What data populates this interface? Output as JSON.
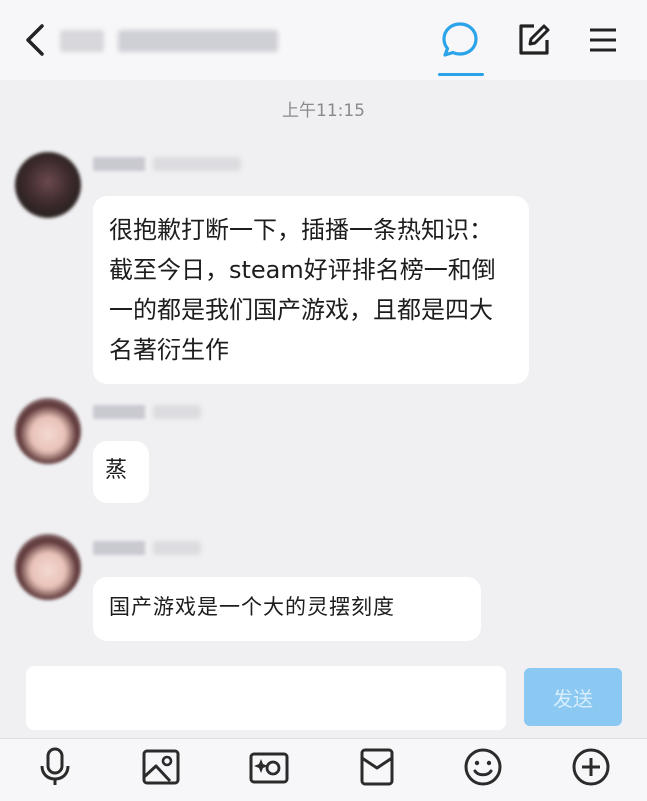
{
  "header": {
    "icons": [
      "back-icon",
      "chat-icon",
      "edit-icon",
      "menu-icon"
    ],
    "active_tab": "chat"
  },
  "timestamp": "上午11:15",
  "messages": [
    {
      "text": "很抱歉打断一下，插播一条热知识：截至今日，steam好评排名榜一和倒一的都是我们国产游戏，且都是四大名著衍生作"
    },
    {
      "text": "蒸"
    },
    {
      "text": "国产游戏是一个大的灵摆刻度"
    }
  ],
  "composer": {
    "input_value": "",
    "send_label": "发送",
    "send_color": "#8cc9f2"
  },
  "toolbar": {
    "icons": [
      "microphone-icon",
      "image-icon",
      "camera-icon",
      "red-packet-icon",
      "emoji-icon",
      "plus-icon"
    ]
  },
  "colors": {
    "accent": "#2aa3e8",
    "bubble": "#ffffff",
    "background": "#f0f0f2"
  }
}
